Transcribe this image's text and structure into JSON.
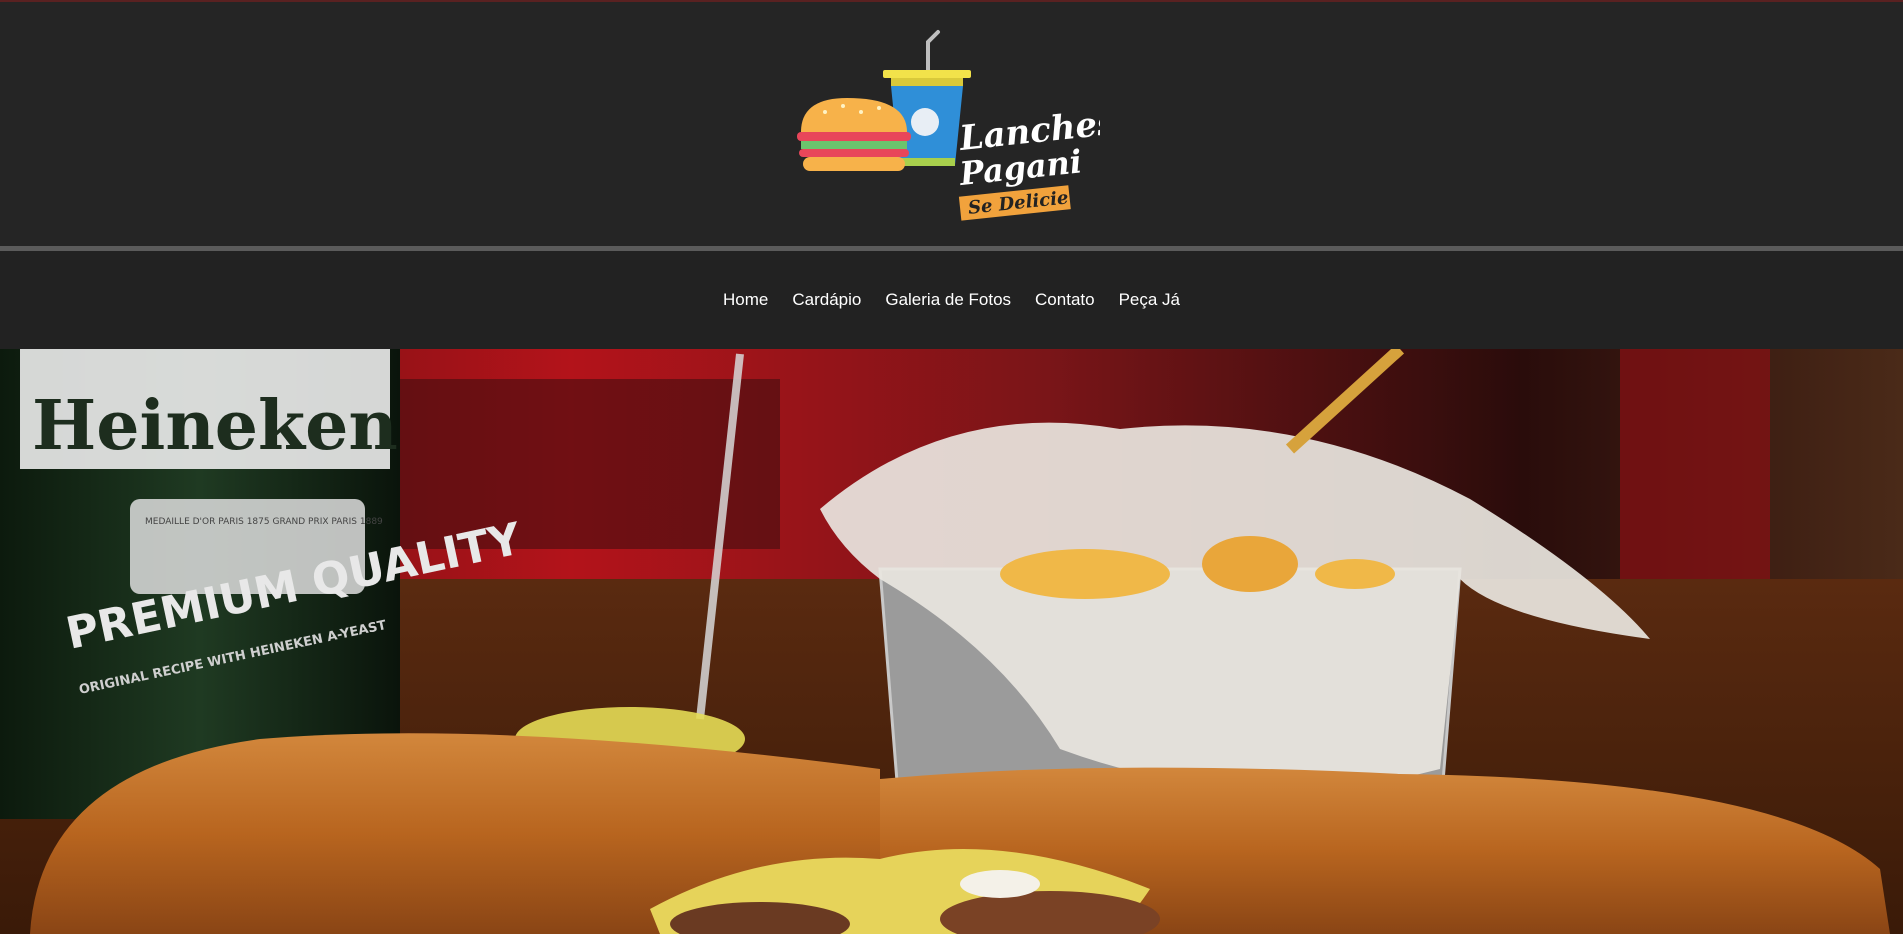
{
  "brand": {
    "name_line1": "Lanches",
    "name_line2": "Pagani",
    "tagline": "Se Delicie",
    "logo_icons": [
      "burger-icon",
      "soda-cup-icon"
    ]
  },
  "nav": {
    "items": [
      {
        "label": "Home"
      },
      {
        "label": "Cardápio"
      },
      {
        "label": "Galeria de Fotos"
      },
      {
        "label": "Contato"
      },
      {
        "label": "Peça Já"
      }
    ]
  },
  "hero": {
    "bottle_label": {
      "brand": "Heineken",
      "line1": "PREMIUM QUALITY",
      "line2": "ORIGINAL RECIPE WITH HEINEKEN A-YEAST",
      "medal_text": "MEDAILLE D'OR PARIS 1875 GRAND PRIX PARIS 1889"
    }
  },
  "colors": {
    "header_bg": "#252525",
    "nav_bg": "#222222",
    "divider": "#5b5b5b",
    "nav_text": "#ffffff",
    "cup_blue": "#2f8fd8",
    "cup_lid": "#f2e24a",
    "tag_orange": "#f1a23c",
    "bun": "#f7b24a",
    "lettuce": "#6bc46d",
    "ketchup": "#e8465a"
  }
}
